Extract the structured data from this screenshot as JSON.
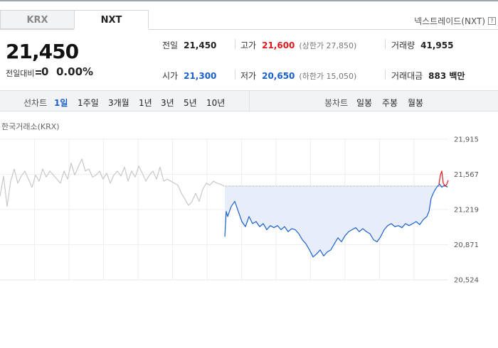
{
  "tabs": [
    {
      "label": "KRX",
      "active": false
    },
    {
      "label": "NXT",
      "active": true
    }
  ],
  "exchange_link": "넥스트레이드(NXT)",
  "help_glyph": "?",
  "quote": {
    "price": "21,450",
    "change_label": "전일대비",
    "change_value": "0",
    "change_pct": "0.00%"
  },
  "stats": {
    "prev": {
      "label": "전일",
      "value": "21,450"
    },
    "high": {
      "label": "고가",
      "value": "21,600",
      "sub": "(상한가 27,850)"
    },
    "volume": {
      "label": "거래량",
      "value": "41,955"
    },
    "open": {
      "label": "시가",
      "value": "21,300"
    },
    "low": {
      "label": "저가",
      "value": "20,650",
      "sub": "(하한가 15,050)"
    },
    "amount": {
      "label": "거래대금",
      "value": "883 백만"
    }
  },
  "line_chart": {
    "label": "선차트",
    "periods": [
      {
        "label": "1일",
        "active": true
      },
      {
        "label": "1주일",
        "active": false
      },
      {
        "label": "3개월",
        "active": false
      },
      {
        "label": "1년",
        "active": false
      },
      {
        "label": "3년",
        "active": false
      },
      {
        "label": "5년",
        "active": false
      },
      {
        "label": "10년",
        "active": false
      }
    ]
  },
  "candle_chart": {
    "label": "봉차트",
    "periods": [
      {
        "label": "일봉"
      },
      {
        "label": "주봉"
      },
      {
        "label": "월봉"
      }
    ]
  },
  "colors": {
    "up": "#e0191d",
    "down": "#1a5fd0",
    "flat": "#c8c8c8",
    "fill": "#e7eef9"
  },
  "chart_data": {
    "type": "line",
    "market_label": "한국거래소(KRX)",
    "ylim": [
      20524,
      21915
    ],
    "y_ticks": [
      "21,915",
      "21,567",
      "21,219",
      "20,871",
      "20,524"
    ],
    "baseline": 21450,
    "grid": true,
    "series": [
      {
        "points": [
          [
            0,
            21350
          ],
          [
            5,
            21550
          ],
          [
            10,
            21250
          ],
          [
            15,
            21500
          ],
          [
            20,
            21620
          ],
          [
            25,
            21480
          ],
          [
            30,
            21550
          ],
          [
            35,
            21600
          ],
          [
            40,
            21520
          ],
          [
            45,
            21440
          ],
          [
            50,
            21560
          ],
          [
            55,
            21500
          ],
          [
            60,
            21620
          ],
          [
            65,
            21540
          ],
          [
            70,
            21600
          ],
          [
            75,
            21560
          ],
          [
            80,
            21520
          ],
          [
            85,
            21480
          ],
          [
            90,
            21600
          ],
          [
            95,
            21520
          ],
          [
            100,
            21680
          ],
          [
            105,
            21560
          ],
          [
            110,
            21640
          ],
          [
            115,
            21720
          ],
          [
            120,
            21600
          ],
          [
            125,
            21620
          ],
          [
            130,
            21540
          ],
          [
            135,
            21560
          ],
          [
            140,
            21600
          ],
          [
            145,
            21520
          ],
          [
            150,
            21580
          ],
          [
            155,
            21480
          ],
          [
            160,
            21560
          ],
          [
            165,
            21600
          ],
          [
            170,
            21550
          ],
          [
            175,
            21640
          ],
          [
            180,
            21500
          ],
          [
            185,
            21600
          ],
          [
            190,
            21540
          ],
          [
            195,
            21650
          ],
          [
            200,
            21580
          ],
          [
            205,
            21500
          ],
          [
            210,
            21560
          ],
          [
            215,
            21600
          ],
          [
            220,
            21520
          ],
          [
            225,
            21640
          ],
          [
            230,
            21500
          ],
          [
            235,
            21520
          ],
          [
            240,
            21500
          ],
          [
            245,
            21480
          ],
          [
            250,
            21460
          ],
          [
            255,
            21380
          ],
          [
            260,
            21320
          ],
          [
            265,
            21260
          ],
          [
            270,
            21300
          ],
          [
            275,
            21380
          ],
          [
            280,
            21300
          ],
          [
            285,
            21420
          ],
          [
            290,
            21480
          ],
          [
            295,
            21460
          ],
          [
            300,
            21500
          ],
          [
            305,
            21480
          ],
          [
            310,
            21470
          ],
          [
            315,
            21450
          ]
        ],
        "color": "#c8c8c8"
      },
      {
        "points": [
          [
            316,
            20950
          ],
          [
            318,
            21200
          ],
          [
            320,
            21150
          ],
          [
            325,
            21250
          ],
          [
            330,
            21300
          ],
          [
            335,
            21200
          ],
          [
            340,
            21100
          ],
          [
            345,
            21050
          ],
          [
            350,
            21150
          ],
          [
            355,
            21080
          ],
          [
            360,
            21100
          ],
          [
            365,
            21050
          ],
          [
            370,
            21080
          ],
          [
            375,
            21020
          ],
          [
            380,
            21060
          ],
          [
            385,
            21040
          ],
          [
            390,
            21060
          ],
          [
            395,
            21020
          ],
          [
            400,
            21050
          ],
          [
            405,
            21000
          ],
          [
            410,
            21030
          ],
          [
            415,
            21020
          ],
          [
            420,
            20980
          ],
          [
            425,
            20920
          ],
          [
            430,
            20880
          ],
          [
            435,
            20820
          ],
          [
            440,
            20750
          ],
          [
            445,
            20780
          ],
          [
            450,
            20820
          ],
          [
            455,
            20760
          ],
          [
            460,
            20800
          ],
          [
            465,
            20820
          ],
          [
            470,
            20880
          ],
          [
            475,
            20940
          ],
          [
            480,
            20900
          ],
          [
            485,
            20960
          ],
          [
            490,
            21000
          ],
          [
            495,
            21020
          ],
          [
            500,
            21040
          ],
          [
            505,
            21000
          ],
          [
            510,
            21030
          ],
          [
            515,
            21000
          ],
          [
            520,
            20980
          ],
          [
            525,
            20920
          ],
          [
            530,
            20900
          ],
          [
            535,
            20950
          ],
          [
            540,
            21020
          ],
          [
            545,
            21060
          ],
          [
            550,
            21080
          ],
          [
            555,
            21050
          ],
          [
            560,
            21060
          ],
          [
            565,
            21040
          ],
          [
            570,
            21080
          ],
          [
            575,
            21060
          ],
          [
            580,
            21080
          ],
          [
            585,
            21100
          ],
          [
            590,
            21070
          ],
          [
            595,
            21120
          ],
          [
            600,
            21150
          ],
          [
            603,
            21200
          ],
          [
            606,
            21330
          ],
          [
            609,
            21380
          ],
          [
            612,
            21420
          ],
          [
            615,
            21450
          ],
          [
            618,
            21470
          ],
          [
            621,
            21440
          ],
          [
            625,
            21460
          ],
          [
            629,
            21440
          ]
        ],
        "color": "#1a5fd0"
      },
      {
        "points": [
          [
            617,
            21470
          ],
          [
            619,
            21560
          ],
          [
            621,
            21600
          ],
          [
            623,
            21480
          ],
          [
            626,
            21450
          ],
          [
            628,
            21470
          ],
          [
            630,
            21510
          ]
        ],
        "color": "#e0191d"
      }
    ]
  }
}
